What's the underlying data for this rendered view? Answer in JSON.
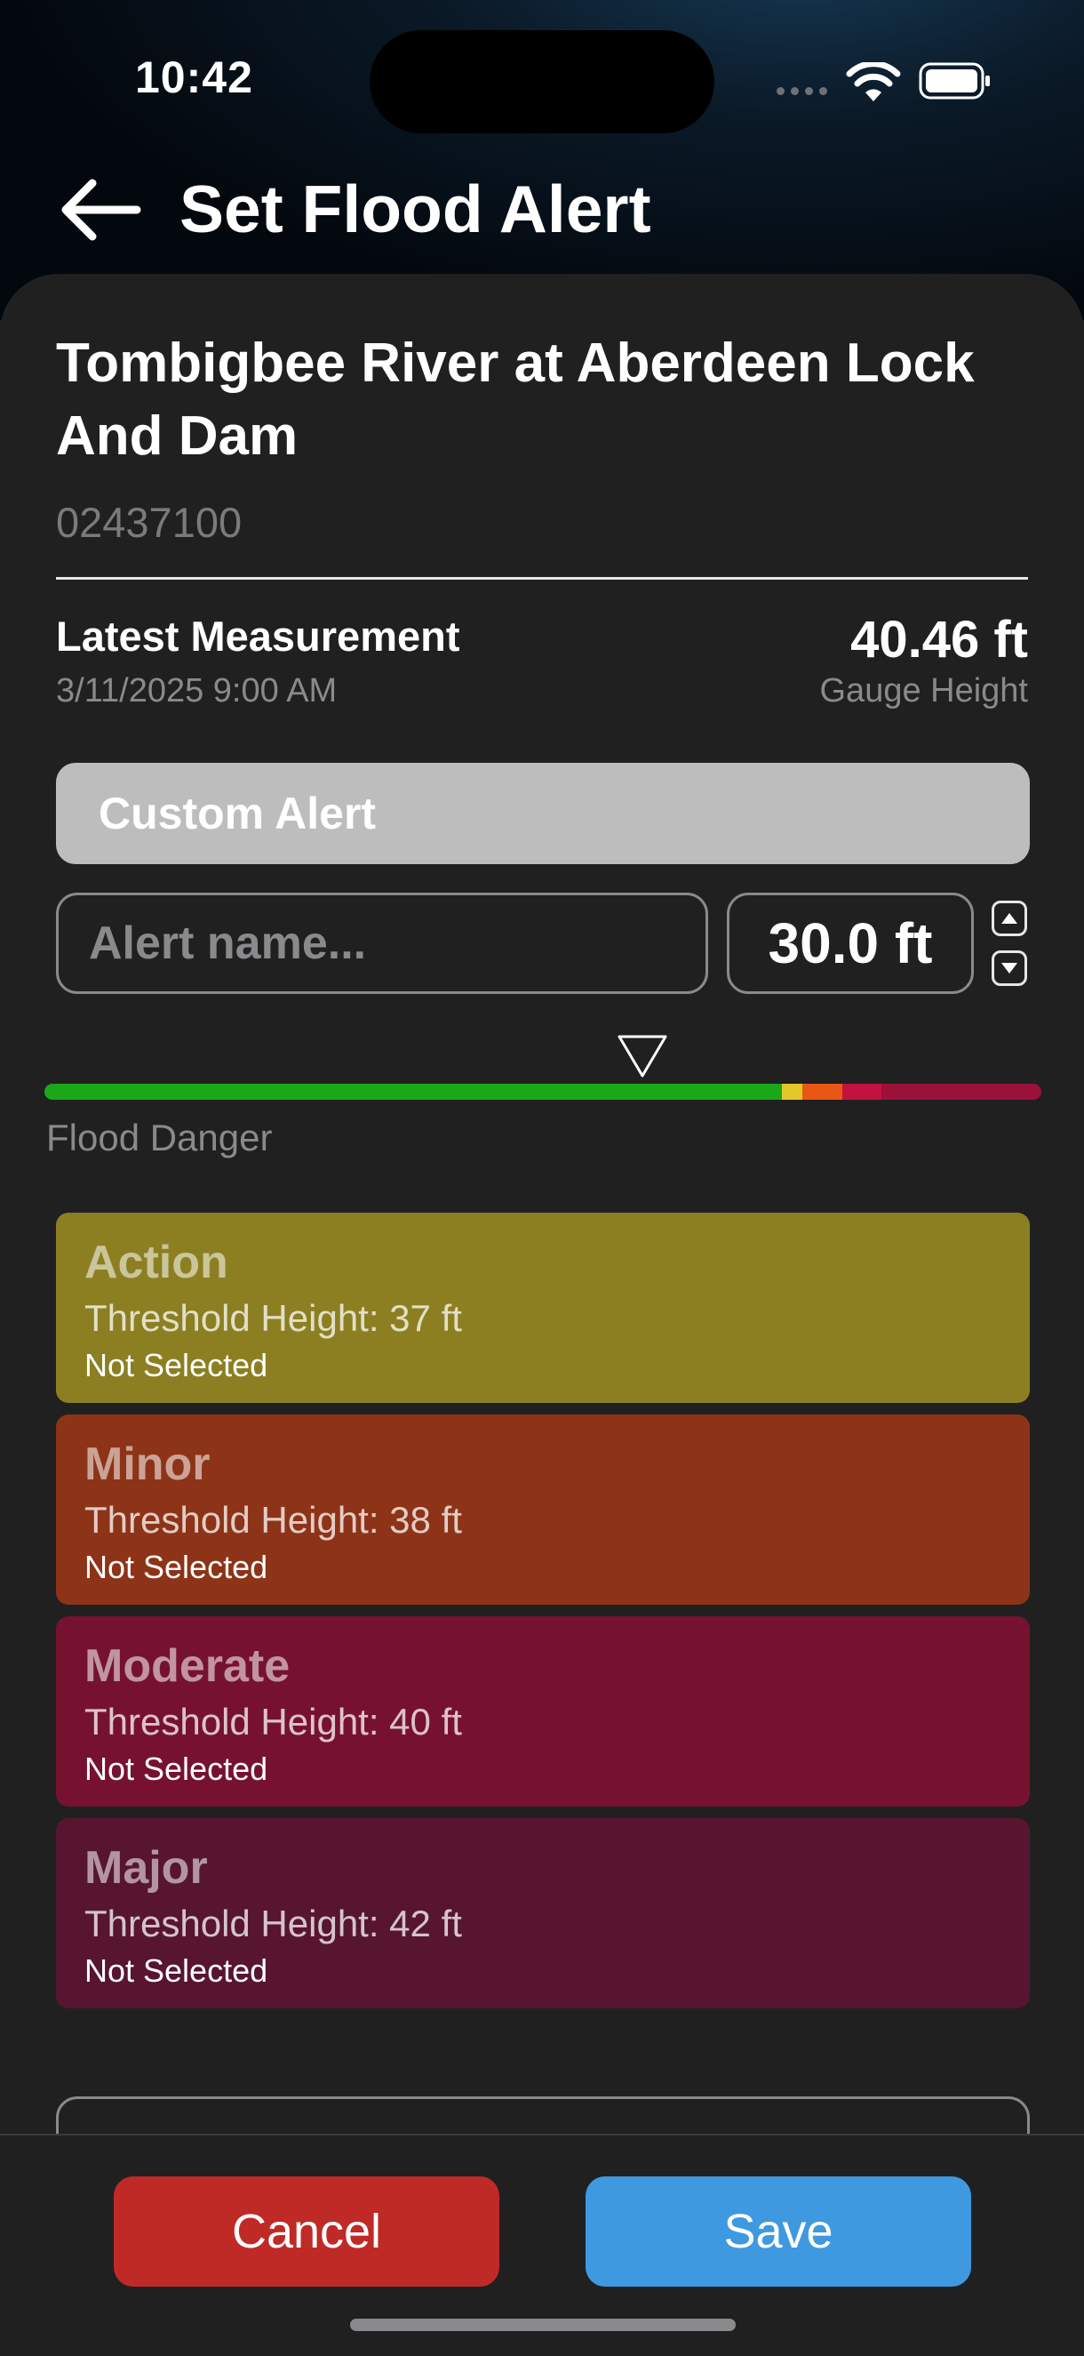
{
  "status_bar": {
    "time": "10:42",
    "wifi_icon": "wifi-icon",
    "battery_icon": "battery-icon"
  },
  "header": {
    "title": "Set Flood Alert",
    "back_icon": "arrow-left-icon"
  },
  "station": {
    "name": "Tombigbee River at Aberdeen Lock And Dam",
    "id": "02437100"
  },
  "measurement": {
    "label": "Latest Measurement",
    "date": "3/11/2025 9:00 AM",
    "value": "40.46 ft",
    "type": "Gauge Height"
  },
  "custom_alert": {
    "label": "Custom Alert",
    "name_placeholder": "Alert name...",
    "height_value": "30.0  ft"
  },
  "danger_scale": {
    "label": "Flood Danger",
    "marker_fraction": 0.6,
    "segments": [
      {
        "name": "normal",
        "fraction": 0.74,
        "color": "#1aa819"
      },
      {
        "name": "action",
        "fraction": 0.02,
        "color": "#e3c82a"
      },
      {
        "name": "minor",
        "fraction": 0.04,
        "color": "#e85714"
      },
      {
        "name": "moderate",
        "fraction": 0.04,
        "color": "#c3123f"
      },
      {
        "name": "major",
        "fraction": 0.16,
        "color": "#9a1139"
      }
    ]
  },
  "tiers": [
    {
      "name": "Action",
      "threshold": "Threshold Height: 37 ft",
      "status": "Not Selected",
      "color": "#8c7f22"
    },
    {
      "name": "Minor",
      "threshold": "Threshold Height: 38 ft",
      "status": "Not Selected",
      "color": "#8d3317"
    },
    {
      "name": "Moderate",
      "threshold": "Threshold Height: 40 ft",
      "status": "Not Selected",
      "color": "#76122f"
    },
    {
      "name": "Major",
      "threshold": "Threshold Height: 42 ft",
      "status": "Not Selected",
      "color": "#57152f"
    }
  ],
  "actions": {
    "cancel": "Cancel",
    "save": "Save",
    "cancel_color": "#c02a26",
    "save_color": "#3f99e0"
  }
}
